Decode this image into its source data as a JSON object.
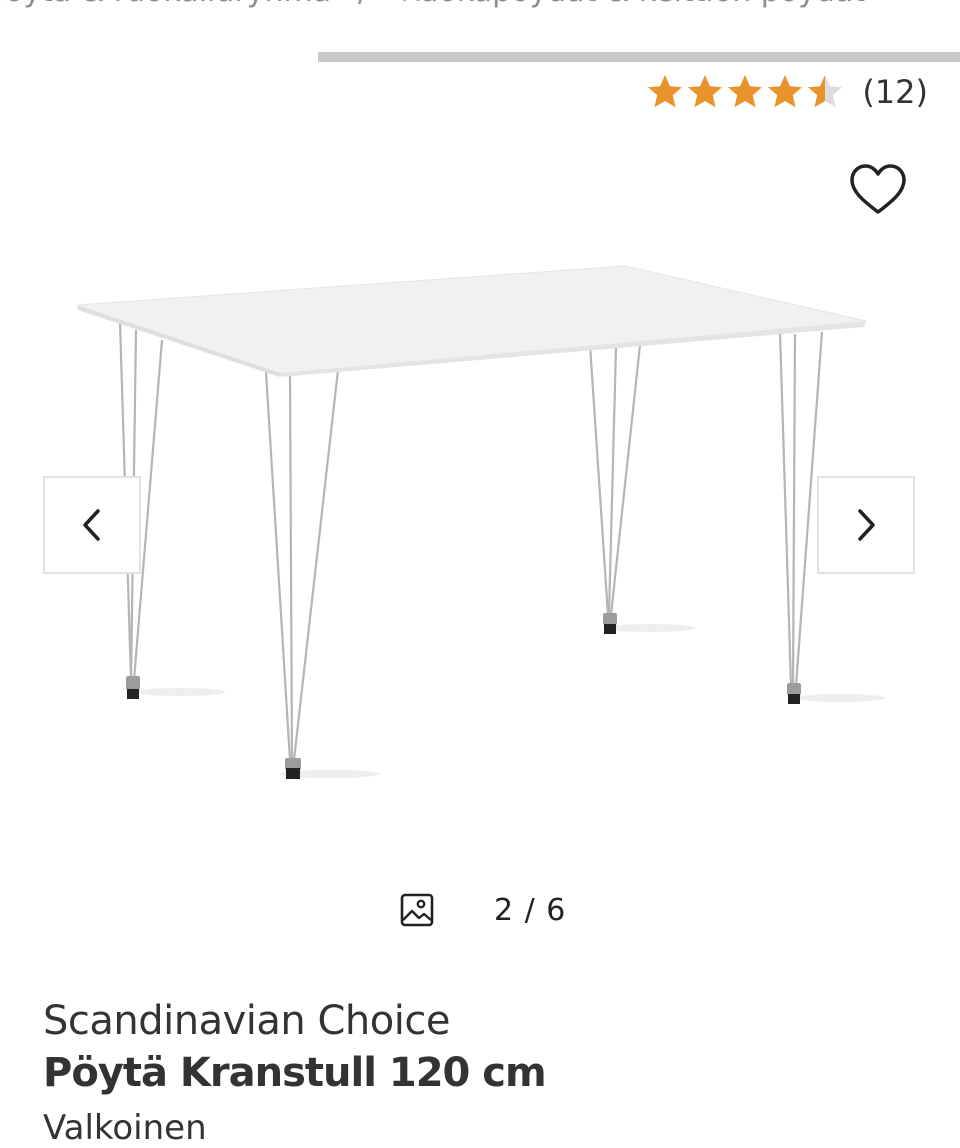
{
  "breadcrumb": {
    "items": [
      "pöytä & ruokailuryhmä",
      "Ruokapöydät & keittiön pöydät"
    ],
    "separator": "/"
  },
  "rating": {
    "value": 4.5,
    "max": 5,
    "count_label": "(12)",
    "star_color": "#e8942a",
    "empty_color": "#dddddd"
  },
  "wishlist": {
    "icon": "heart-outline-icon"
  },
  "gallery": {
    "counter": "2 / 6",
    "current": 2,
    "total": 6,
    "prev_icon": "chevron-left-icon",
    "next_icon": "chevron-right-icon",
    "image_icon": "image-icon"
  },
  "product": {
    "brand": "Scandinavian Choice",
    "name": "Pöytä Kranstull 120 cm",
    "variant": "Valkoinen"
  }
}
